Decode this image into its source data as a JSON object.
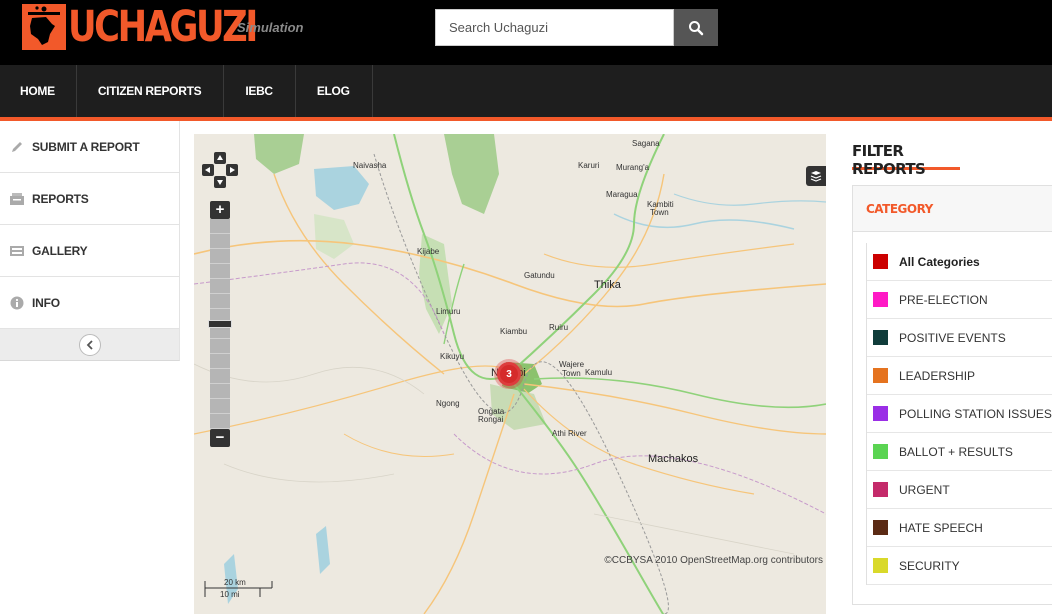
{
  "header": {
    "logo_text": "UCHAGUZI",
    "tagline": "Simulation",
    "search": {
      "placeholder": "Search Uchaguzi"
    },
    "icons": {
      "search": "search-icon"
    }
  },
  "nav": {
    "items": [
      {
        "label": "HOME"
      },
      {
        "label": "CITIZEN REPORTS"
      },
      {
        "label": "IEBC"
      },
      {
        "label": "ELOG"
      }
    ]
  },
  "sidebar": {
    "items": [
      {
        "label": "SUBMIT A REPORT",
        "icon": "pencil-icon"
      },
      {
        "label": "REPORTS",
        "icon": "reports-icon"
      },
      {
        "label": "GALLERY",
        "icon": "gallery-icon"
      },
      {
        "label": "INFO",
        "icon": "info-icon"
      }
    ]
  },
  "map": {
    "labels": [
      "Naivasha",
      "Karuri",
      "Murang'a",
      "Sagana",
      "Maragua",
      "Kambiti",
      "Town",
      "Kijabe",
      "Gatundu",
      "Thika",
      "Limuru",
      "Kiambu",
      "Ruiru",
      "Kikuyu",
      "Nairobi",
      "Wajere",
      "Town",
      "Kamulu",
      "Ngong",
      "Ongata",
      "Rongai",
      "Athi River",
      "Machakos"
    ],
    "cluster_count": "3",
    "attribution": "©CCBYSA 2010 OpenStreetMap.org contributors",
    "scale": {
      "km": "20 km",
      "mi": "10 mi"
    },
    "zoom_in": "+",
    "zoom_out": "−"
  },
  "filter": {
    "title": "FILTER REPORTS",
    "category_heading": "CATEGORY",
    "categories": [
      {
        "label": "All Categories",
        "color": "#cc0000"
      },
      {
        "label": "PRE-ELECTION",
        "color": "#ff19c5"
      },
      {
        "label": "POSITIVE EVENTS",
        "color": "#0f3c3a"
      },
      {
        "label": "LEADERSHIP",
        "color": "#e5731f"
      },
      {
        "label": "POLLING STATION ISSUES",
        "color": "#9a2ee6"
      },
      {
        "label": "BALLOT + RESULTS",
        "color": "#5ad452"
      },
      {
        "label": "URGENT",
        "color": "#c42a6a"
      },
      {
        "label": "HATE SPEECH",
        "color": "#5b2a14"
      },
      {
        "label": "SECURITY",
        "color": "#d9d92a"
      }
    ]
  },
  "colors": {
    "accent": "#f2592a",
    "topbar": "#000000",
    "navbar": "#1e1e1e"
  }
}
